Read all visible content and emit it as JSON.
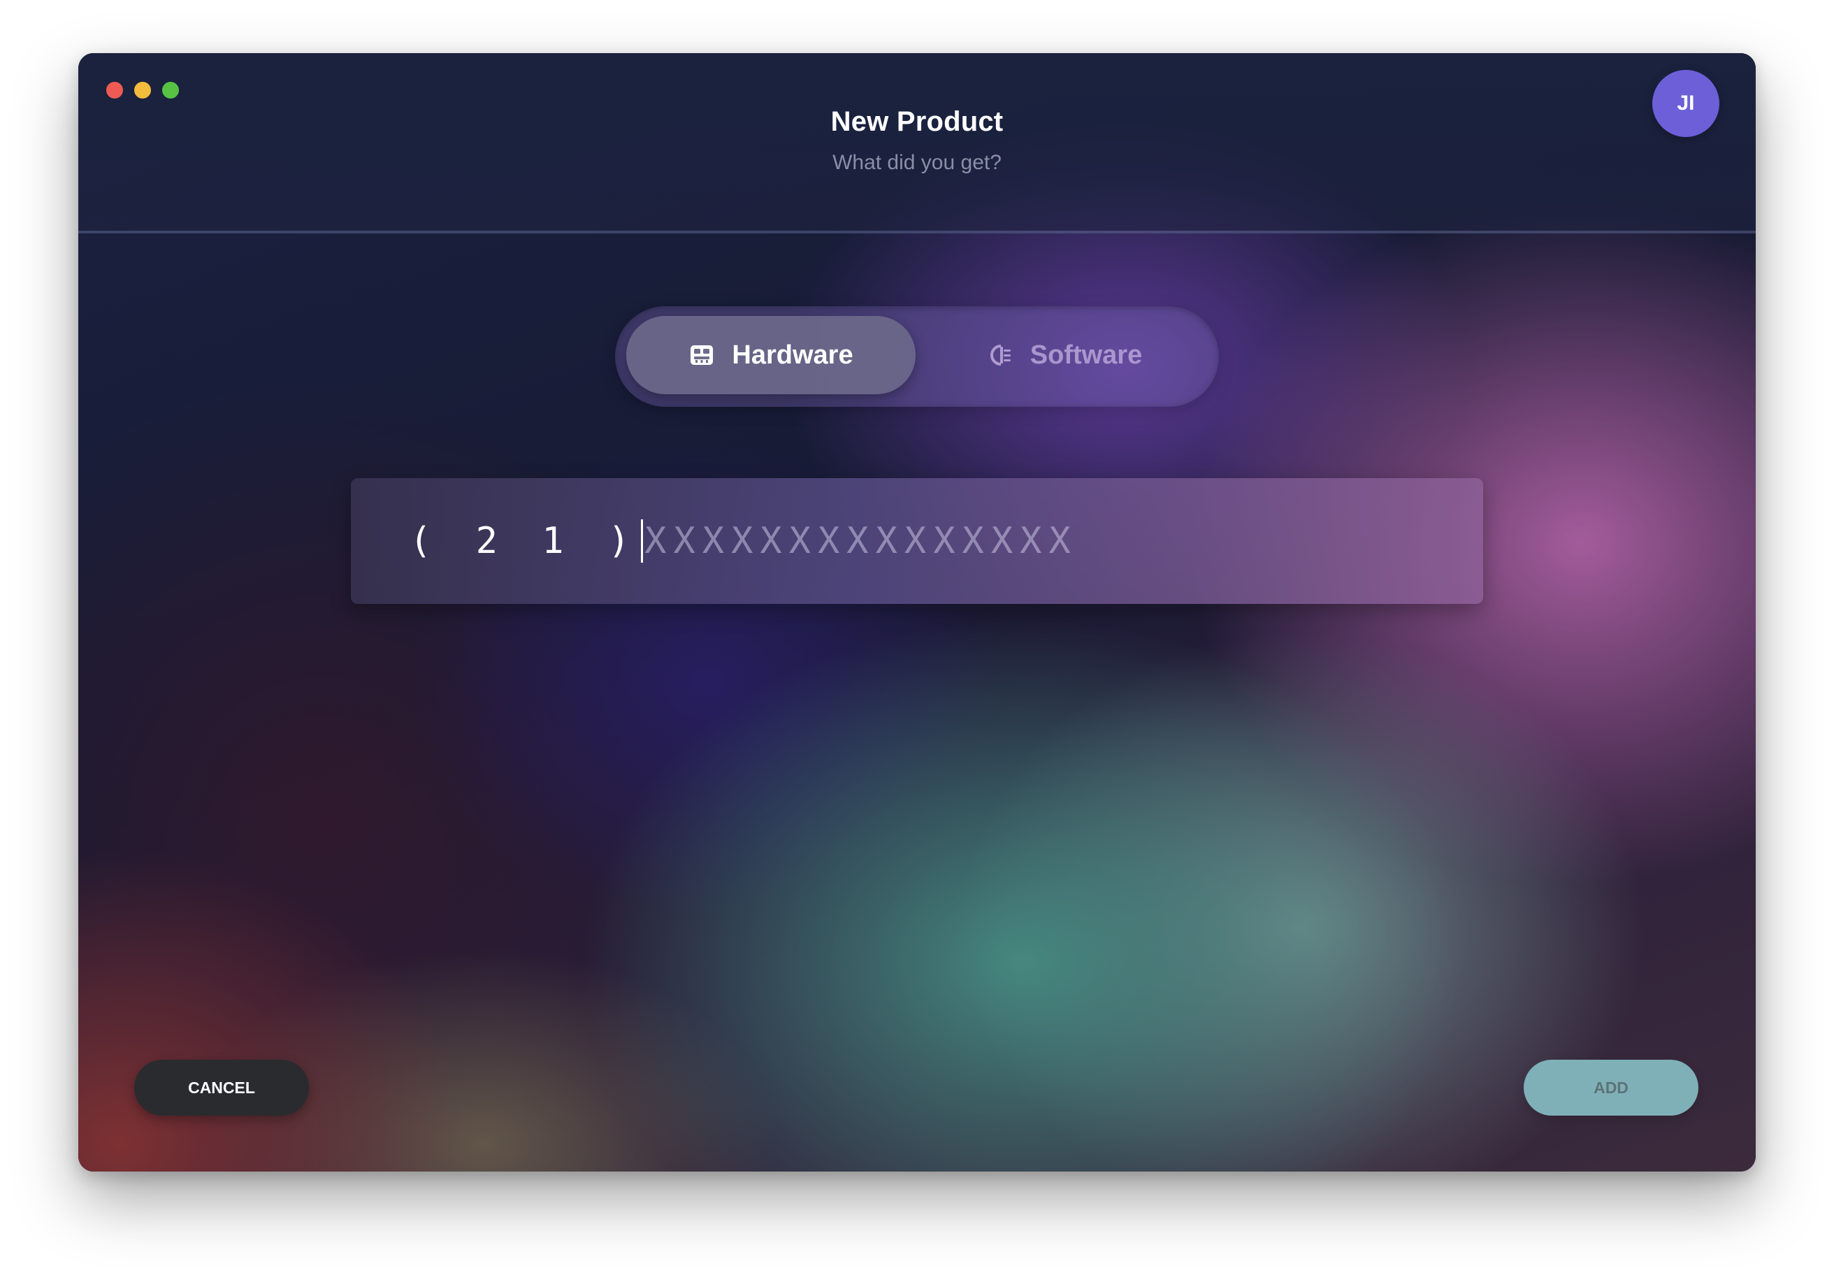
{
  "window": {
    "title": "New Product",
    "subtitle": "What did you get?",
    "controls": [
      "close",
      "minimize",
      "zoom"
    ]
  },
  "user": {
    "initials": "JI",
    "avatar_color": "#6d5fd8"
  },
  "product_type": {
    "selected": "hardware",
    "options": [
      {
        "label": "Hardware",
        "icon": "hardware-icon",
        "active": true
      },
      {
        "label": "Software",
        "icon": "software-icon",
        "active": false
      }
    ]
  },
  "serial_field": {
    "prefix": "(21)",
    "prefix_display": "( 2 1 )",
    "remaining_mask": "XXXXXXXXXXXXXXX"
  },
  "actions": {
    "cancel_label": "CANCEL",
    "add_label": "ADD",
    "add_color": "#7fb0b8",
    "cancel_color": "#2a2b2f"
  }
}
